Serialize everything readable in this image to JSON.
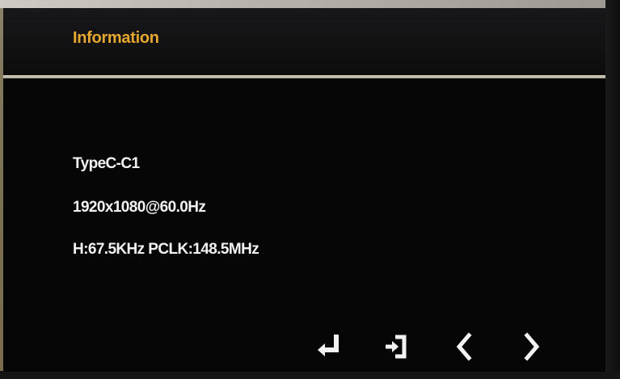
{
  "osd": {
    "title": "Information",
    "lines": [
      "TypeC-C1",
      "1920x1080@60.0Hz",
      "H:67.5KHz PCLK:148.5MHz"
    ],
    "nav": [
      {
        "icon": "enter-icon"
      },
      {
        "icon": "exit-icon"
      },
      {
        "icon": "chevron-left-icon"
      },
      {
        "icon": "chevron-right-icon"
      }
    ]
  },
  "colors": {
    "title": "#e8a72e",
    "text": "#f2f2f2",
    "background": "#060607",
    "divider": "#d8d2c0"
  }
}
